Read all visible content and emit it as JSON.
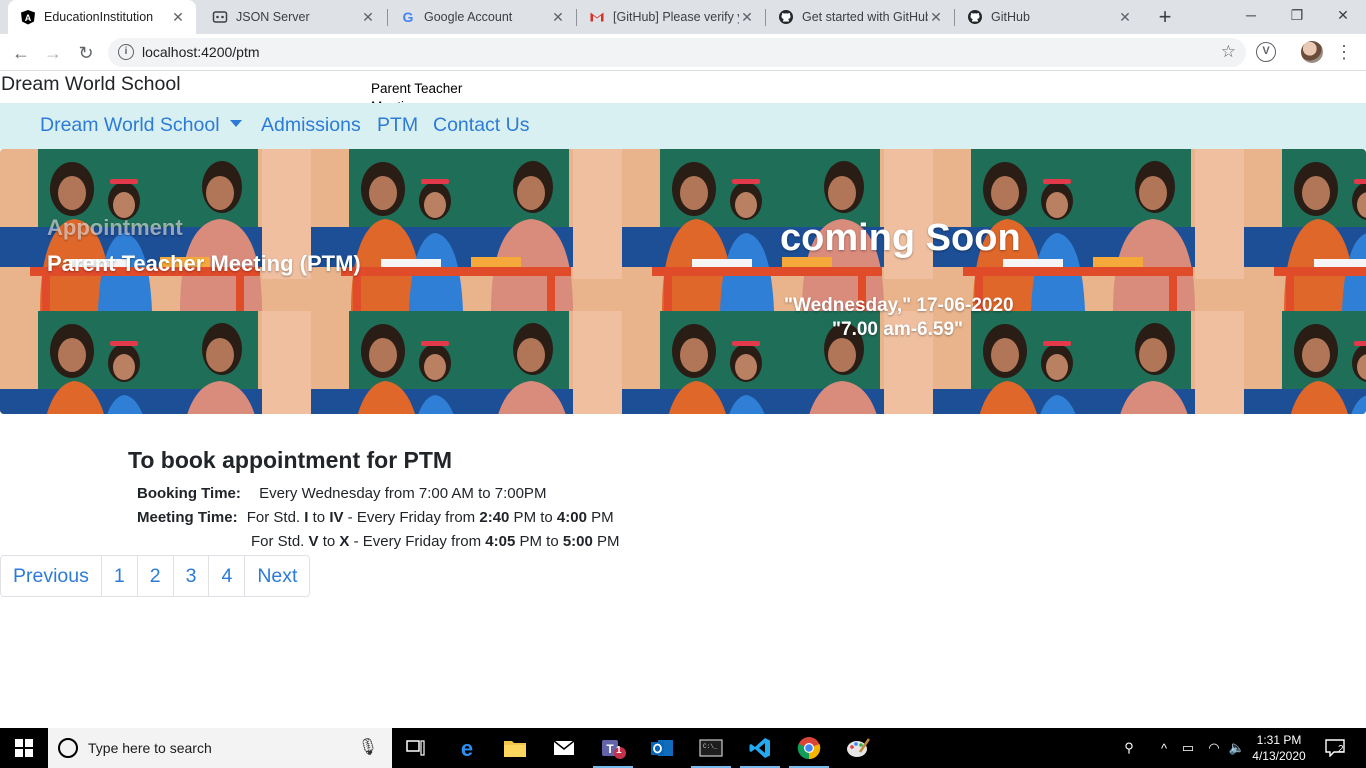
{
  "browser": {
    "tabs": [
      {
        "title": "EducationInstitution",
        "icon": "angular-icon",
        "active": true
      },
      {
        "title": "JSON Server",
        "icon": "json-server-icon",
        "active": false
      },
      {
        "title": "Google Account",
        "icon": "google-icon",
        "active": false
      },
      {
        "title": "[GitHub] Please verify y",
        "icon": "gmail-icon",
        "active": false
      },
      {
        "title": "Get started with GitHub",
        "icon": "github-icon",
        "active": false
      },
      {
        "title": "GitHub",
        "icon": "github-icon",
        "active": false
      }
    ],
    "url": "localhost:4200/ptm"
  },
  "page": {
    "brand": "Dream World School",
    "ptm_caption": "Parent Teacher Meeting",
    "nav": {
      "dropdown": "Dream World School",
      "admissions": "Admissions",
      "ptm": "PTM",
      "contact": "Contact Us"
    },
    "hero": {
      "label": "Appointment",
      "title": "Parent Teacher Meeting (PTM)",
      "coming": "coming Soon",
      "date": "\"Wednesday,\" 17-06-2020",
      "time": "\"7.00 am-6.59\""
    },
    "booking": {
      "title": "To book appointment for PTM",
      "booking_label": "Booking Time:",
      "booking_value": "Every Wednesday from 7:00 AM to 7:00PM",
      "meeting_label": "Meeting Time:",
      "rows": [
        {
          "p1": "For Std. ",
          "b1": "I",
          "p2": " to ",
          "b2": "IV",
          "p3": " - Every Friday from ",
          "b3": "2:40",
          "p4": " PM to ",
          "b4": "4:00",
          "p5": " PM"
        },
        {
          "p1": "For Std. ",
          "b1": "V",
          "p2": " to ",
          "b2": "X",
          "p3": " - Every Friday from ",
          "b3": "4:05",
          "p4": " PM to ",
          "b4": "5:00",
          "p5": " PM"
        }
      ]
    },
    "pagination": {
      "previous": "Previous",
      "pages": [
        "1",
        "2",
        "3",
        "4"
      ],
      "next": "Next"
    }
  },
  "taskbar": {
    "search_placeholder": "Type here to search",
    "time": "1:31 PM",
    "date": "4/13/2020",
    "teams_badge": "1",
    "notifications": "2"
  },
  "colors": {
    "navbar_bg": "#d9f0f2",
    "link": "#2c7bd6"
  }
}
